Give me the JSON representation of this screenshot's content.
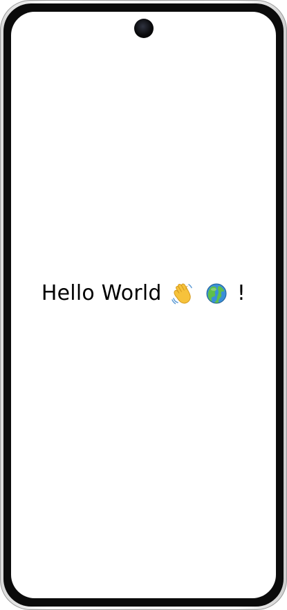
{
  "screen": {
    "greeting_text_1": "Hello World",
    "greeting_emoji_wave": "👋",
    "greeting_emoji_globe": "🌍",
    "greeting_suffix": "!"
  },
  "icons": {
    "wave": "waving-hand-icon",
    "globe": "globe-icon"
  },
  "colors": {
    "text": "#000000",
    "background": "#ffffff"
  }
}
